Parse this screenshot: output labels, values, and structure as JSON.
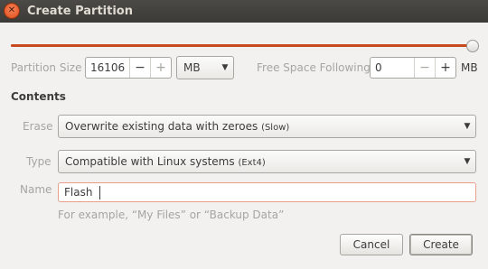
{
  "window": {
    "title": "Create Partition",
    "close_glyph": "✕"
  },
  "size": {
    "label": "Partition Size",
    "value": "16106",
    "minus": "−",
    "plus": "+",
    "unit": "MB",
    "slider_fraction": 1.0
  },
  "free_space": {
    "label": "Free Space Following",
    "value": "0",
    "minus": "−",
    "plus": "+",
    "unit": "MB"
  },
  "contents": {
    "heading": "Contents",
    "erase": {
      "label": "Erase",
      "value": "Overwrite existing data with zeroes",
      "hint": "(Slow)"
    },
    "type": {
      "label": "Type",
      "value": "Compatible with Linux systems",
      "hint": "(Ext4)"
    },
    "name": {
      "label": "Name",
      "value": "Flash",
      "example": "For example, “My Files” or “Backup Data”"
    }
  },
  "buttons": {
    "cancel": "Cancel",
    "create": "Create"
  },
  "dropdown_arrow": "▼",
  "colors": {
    "accent": "#c74a1e",
    "titlebar": "#3c3b37",
    "background": "#f2f1f0"
  }
}
